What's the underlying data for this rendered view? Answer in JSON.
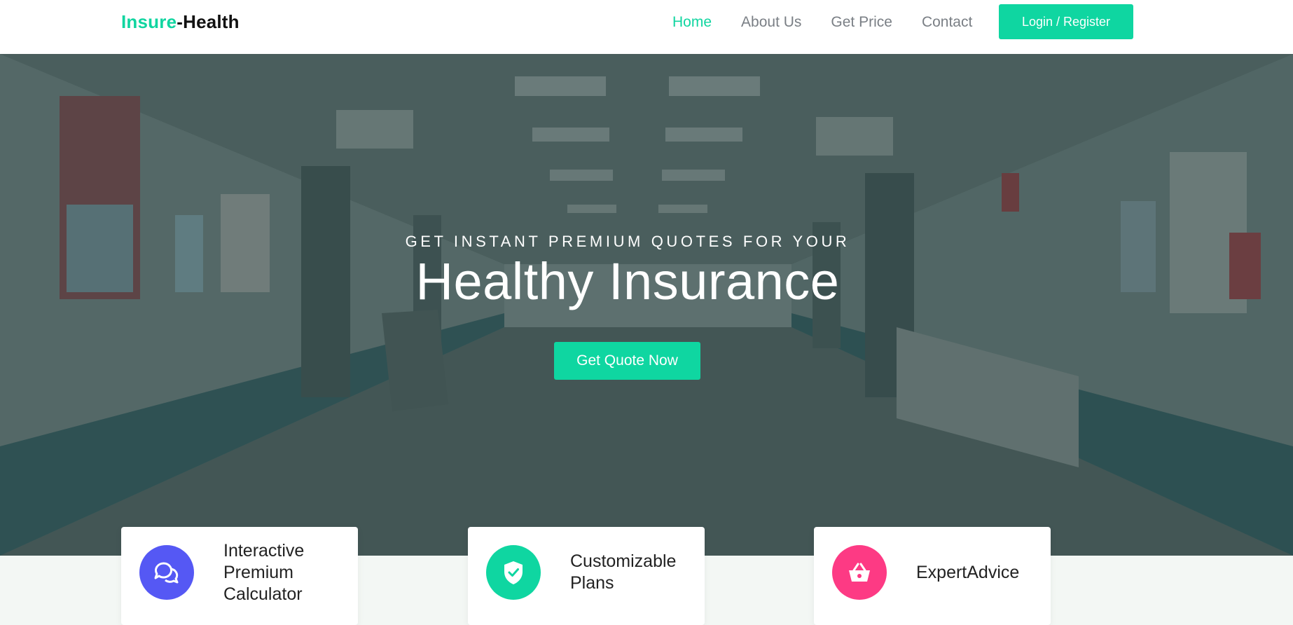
{
  "brand": {
    "part1": "Insure",
    "part2": "-Health"
  },
  "nav": {
    "items": [
      {
        "label": "Home",
        "active": true
      },
      {
        "label": "About Us",
        "active": false
      },
      {
        "label": "Get Price",
        "active": false
      },
      {
        "label": "Contact",
        "active": false
      }
    ],
    "login_label": "Login / Register"
  },
  "hero": {
    "subtitle": "GET INSTANT PREMIUM QUOTES FOR YOUR",
    "title": "Healthy Insurance",
    "cta_label": "Get Quote Now"
  },
  "features": [
    {
      "label": "Interactive Premium Calculator",
      "icon": "chat-bubbles-icon",
      "color": "#5558f4"
    },
    {
      "label": "Customizable Plans",
      "icon": "shield-check-icon",
      "color": "#0fd6a1"
    },
    {
      "label": "ExpertAdvice",
      "icon": "basket-icon",
      "color": "#fd3a84"
    }
  ],
  "colors": {
    "accent": "#0fd6a1",
    "nav_text": "#7a7f85",
    "page_bg": "#f3f7f4"
  }
}
